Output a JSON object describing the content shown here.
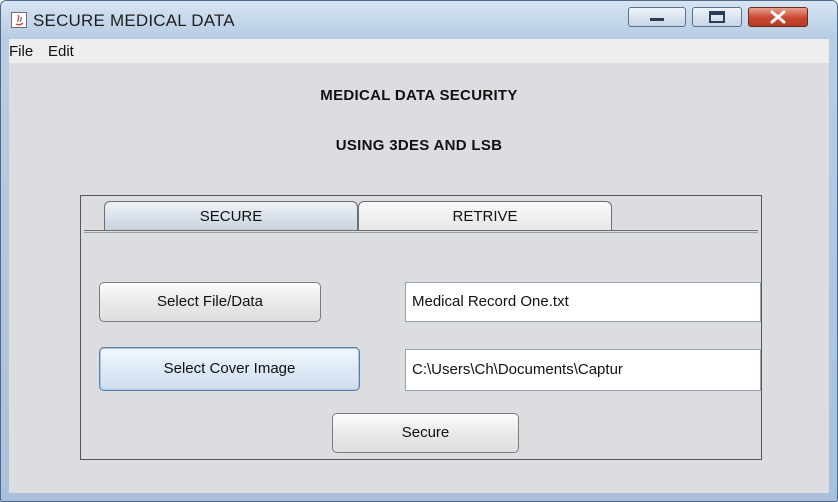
{
  "window": {
    "title": "SECURE MEDICAL DATA"
  },
  "menubar": {
    "items": [
      {
        "label": "File"
      },
      {
        "label": "Edit"
      }
    ]
  },
  "main": {
    "heading_line1": "MEDICAL DATA SECURITY",
    "heading_line2": "USING 3DES AND LSB"
  },
  "tabs": [
    {
      "label": "SECURE",
      "selected": true
    },
    {
      "label": "RETRIVE",
      "selected": false
    }
  ],
  "secure_tab": {
    "select_file_button": "Select File/Data",
    "file_field_value": "Medical Record One.txt",
    "select_cover_button": "Select Cover Image",
    "cover_field_value": "C:\\Users\\Ch\\Documents\\Captur",
    "secure_button": "Secure"
  },
  "colors": {
    "title_bar": "#c2d5ea",
    "panel_background": "#dcdde1",
    "close_button": "#c9472f"
  }
}
